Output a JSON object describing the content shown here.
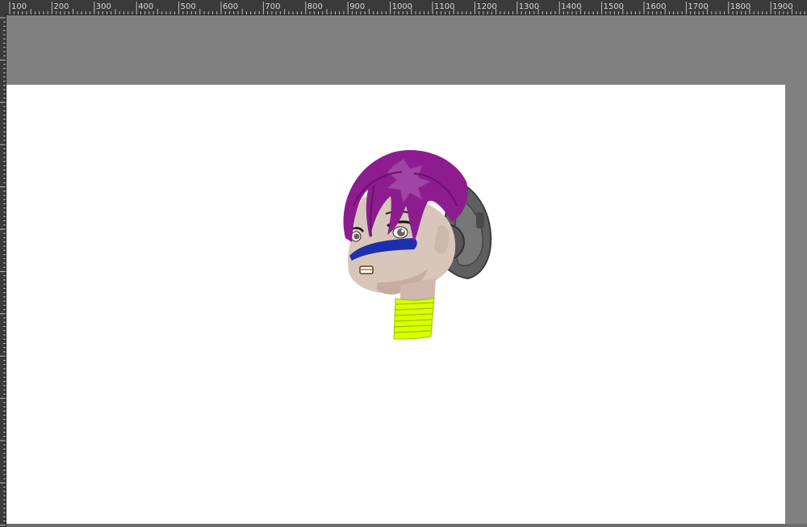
{
  "ruler": {
    "labels": [
      "100",
      "200",
      "300",
      "400",
      "500",
      "600",
      "700",
      "800",
      "900",
      "1000",
      "1100",
      "1200",
      "1300",
      "1400",
      "1500",
      "1600",
      "1700",
      "1800",
      "1900"
    ],
    "label_color": "#d8d8d8",
    "tick_color": "#bdbdbd"
  },
  "colors": {
    "workspace": "#808080",
    "canvas": "#ffffff",
    "hair": "#8d1d8f",
    "skin": "#d7c6b9",
    "visor": "#1d2fb0",
    "helmet": "#5d5d5d",
    "collar": "#d9ff00"
  }
}
